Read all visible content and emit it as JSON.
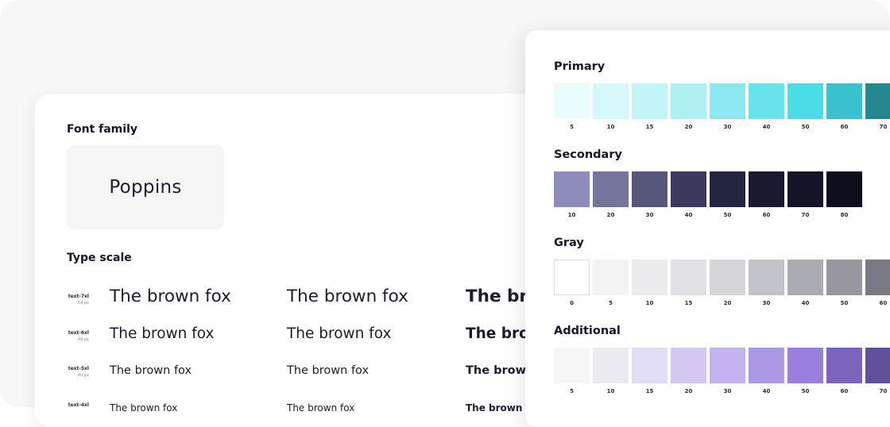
{
  "typography": {
    "font_family_title": "Font family",
    "font_name": "Poppins",
    "type_scale_title": "Type scale",
    "sample_text": "The brown fox",
    "scales": [
      {
        "name": "text-7xl",
        "size": "54 px"
      },
      {
        "name": "text-6xl",
        "size": "48 px"
      },
      {
        "name": "text-5xl",
        "size": "40 px"
      },
      {
        "name": "text-4xl",
        "size": ""
      }
    ]
  },
  "palettes": [
    {
      "title": "Primary",
      "swatches": [
        {
          "label": "5",
          "color": "#eafcfd"
        },
        {
          "label": "10",
          "color": "#d5f8fb"
        },
        {
          "label": "15",
          "color": "#c2f4f8"
        },
        {
          "label": "20",
          "color": "#b0f0f5"
        },
        {
          "label": "30",
          "color": "#8be8f0"
        },
        {
          "label": "40",
          "color": "#69e3ec"
        },
        {
          "label": "50",
          "color": "#4bdce7"
        },
        {
          "label": "60",
          "color": "#39c2cd"
        },
        {
          "label": "70",
          "color": "#258890"
        }
      ]
    },
    {
      "title": "Secondary",
      "swatches": [
        {
          "label": "10",
          "color": "#8d8dbb"
        },
        {
          "label": "20",
          "color": "#75759c"
        },
        {
          "label": "30",
          "color": "#55567a"
        },
        {
          "label": "40",
          "color": "#3b3a5c"
        },
        {
          "label": "50",
          "color": "#232440"
        },
        {
          "label": "60",
          "color": "#191a30"
        },
        {
          "label": "70",
          "color": "#141526"
        },
        {
          "label": "80",
          "color": "#0e0f1d"
        }
      ]
    },
    {
      "title": "Gray",
      "swatches": [
        {
          "label": "0",
          "color": "#ffffff"
        },
        {
          "label": "5",
          "color": "#f3f3f4"
        },
        {
          "label": "10",
          "color": "#ebebee"
        },
        {
          "label": "15",
          "color": "#e1e1e5"
        },
        {
          "label": "20",
          "color": "#d4d4d9"
        },
        {
          "label": "30",
          "color": "#c2c2c9"
        },
        {
          "label": "40",
          "color": "#ababb3"
        },
        {
          "label": "50",
          "color": "#98979f"
        },
        {
          "label": "60",
          "color": "#7a7a86"
        }
      ]
    },
    {
      "title": "Additional",
      "swatches": [
        {
          "label": "5",
          "color": "#f5f5f6"
        },
        {
          "label": "10",
          "color": "#eaeaf0"
        },
        {
          "label": "15",
          "color": "#e2dcf6"
        },
        {
          "label": "20",
          "color": "#d4c8f3"
        },
        {
          "label": "30",
          "color": "#c3b2ee"
        },
        {
          "label": "40",
          "color": "#ad98e6"
        },
        {
          "label": "50",
          "color": "#997fdc"
        },
        {
          "label": "60",
          "color": "#7c64bc"
        },
        {
          "label": "70",
          "color": "#61519a"
        }
      ]
    }
  ]
}
